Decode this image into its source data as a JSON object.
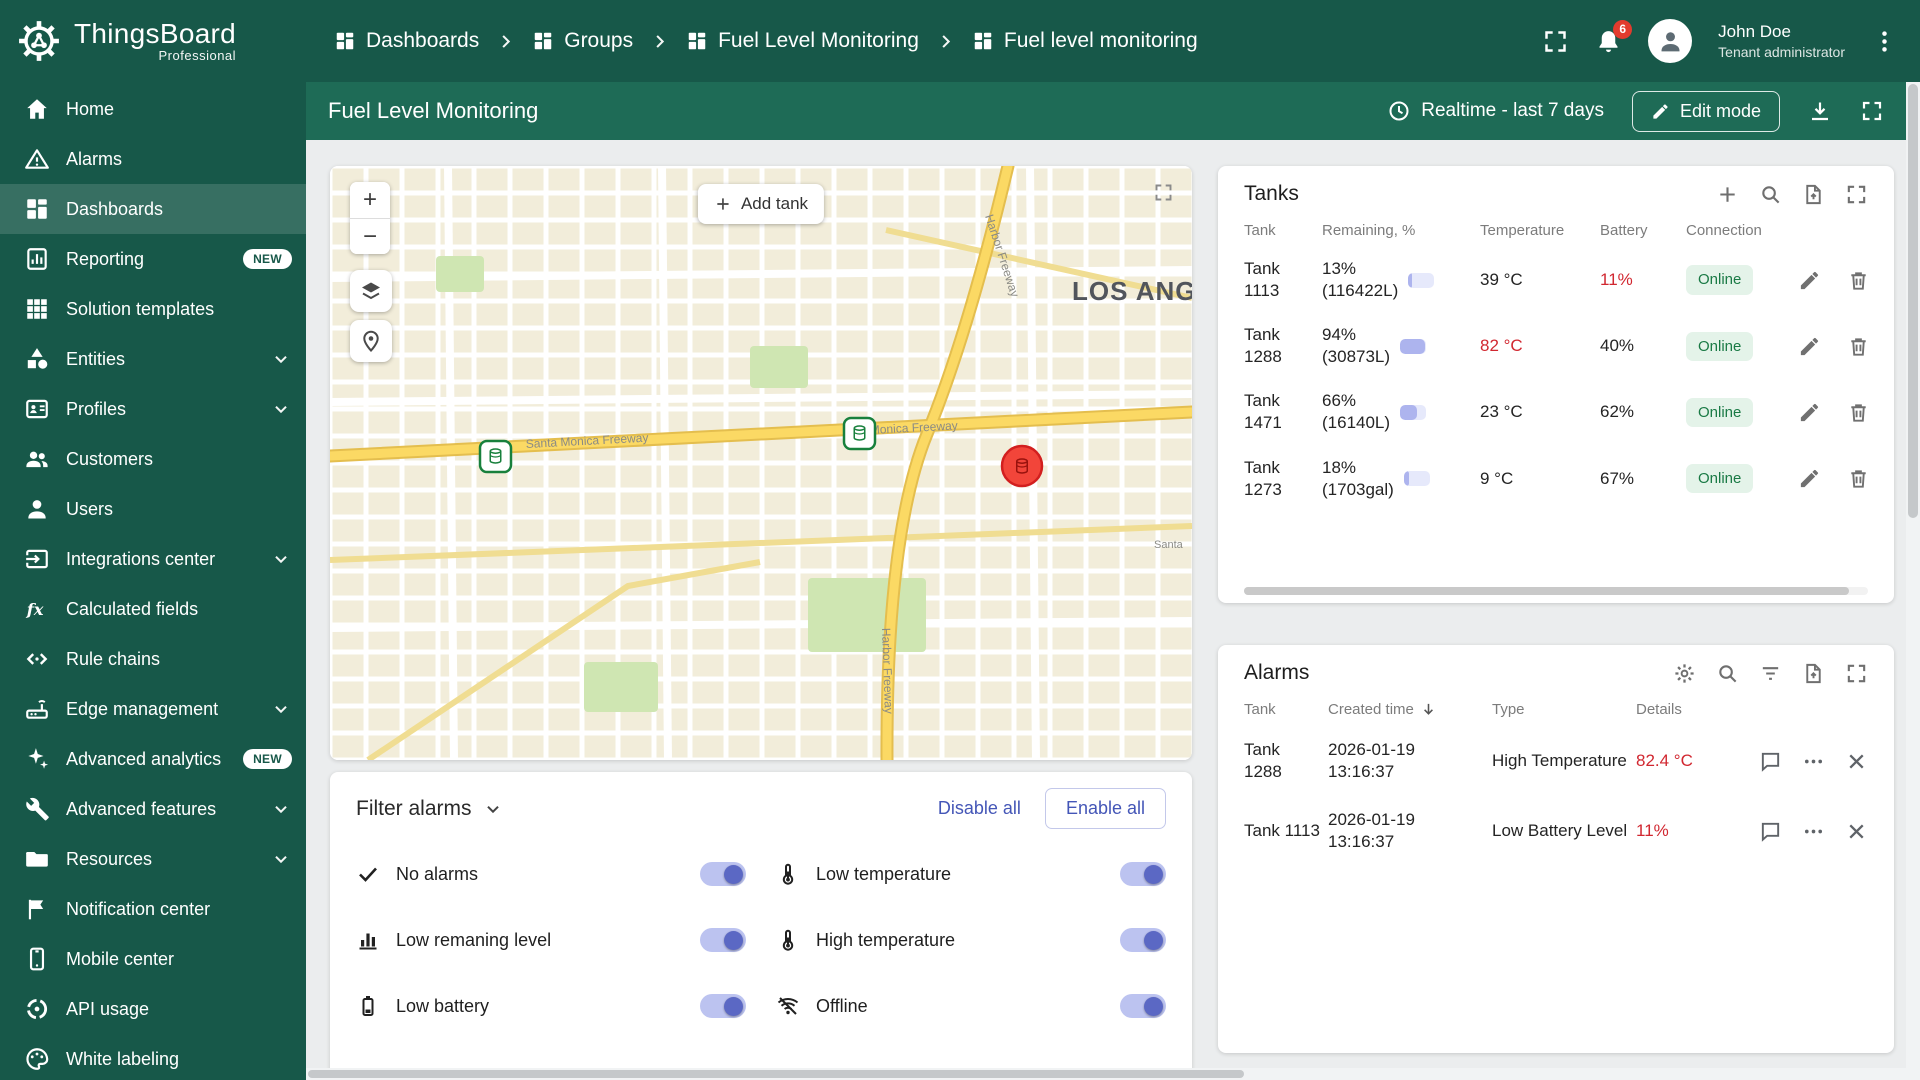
{
  "header": {
    "brand": "ThingsBoard",
    "brand_sub": "Professional",
    "breadcrumbs": [
      "Dashboards",
      "Groups",
      "Fuel Level Monitoring",
      "Fuel level monitoring"
    ],
    "notification_count": "6",
    "user_name": "John Doe",
    "user_role": "Tenant administrator"
  },
  "sidebar": {
    "items": [
      {
        "label": "Home"
      },
      {
        "label": "Alarms"
      },
      {
        "label": "Dashboards",
        "active": true
      },
      {
        "label": "Reporting",
        "badge": "NEW"
      },
      {
        "label": "Solution templates"
      },
      {
        "label": "Entities",
        "expandable": true
      },
      {
        "label": "Profiles",
        "expandable": true
      },
      {
        "label": "Customers"
      },
      {
        "label": "Users"
      },
      {
        "label": "Integrations center",
        "expandable": true
      },
      {
        "label": "Calculated fields"
      },
      {
        "label": "Rule chains"
      },
      {
        "label": "Edge management",
        "expandable": true
      },
      {
        "label": "Advanced analytics",
        "badge": "NEW"
      },
      {
        "label": "Advanced features",
        "expandable": true
      },
      {
        "label": "Resources",
        "expandable": true
      },
      {
        "label": "Notification center"
      },
      {
        "label": "Mobile center"
      },
      {
        "label": "API usage"
      },
      {
        "label": "White labeling"
      }
    ]
  },
  "toolbar": {
    "title": "Fuel Level Monitoring",
    "time_window": "Realtime - last 7 days",
    "edit_mode": "Edit mode"
  },
  "map": {
    "add_tank": "Add tank",
    "zoom_in": "+",
    "zoom_out": "−",
    "city_label": "LOS ANG",
    "road_label_1": "Santa Monica Freeway",
    "road_label_2": "Monica Freeway",
    "road_label_3": "Harbor Freeway",
    "road_label_4": "Harbor Freeway",
    "road_label_5": "Santa"
  },
  "tanks": {
    "title": "Tanks",
    "columns": {
      "tank": "Tank",
      "remaining": "Remaining, %",
      "temperature": "Temperature",
      "battery": "Battery",
      "connection": "Connection"
    },
    "rows": [
      {
        "name": "Tank 1113",
        "remaining_pct": "13%",
        "remaining_vol": "(116422L)",
        "level": 13,
        "temperature": "39 °C",
        "temperature_alarm": false,
        "battery": "11%",
        "battery_alarm": true,
        "connection": "Online"
      },
      {
        "name": "Tank 1288",
        "remaining_pct": "94%",
        "remaining_vol": "(30873L)",
        "level": 94,
        "temperature": "82 °C",
        "temperature_alarm": true,
        "battery": "40%",
        "battery_alarm": false,
        "connection": "Online"
      },
      {
        "name": "Tank 1471",
        "remaining_pct": "66%",
        "remaining_vol": "(16140L)",
        "level": 66,
        "temperature": "23 °C",
        "temperature_alarm": false,
        "battery": "62%",
        "battery_alarm": false,
        "connection": "Online"
      },
      {
        "name": "Tank 1273",
        "remaining_pct": "18%",
        "remaining_vol": "(1703gal)",
        "level": 18,
        "temperature": "9 °C",
        "temperature_alarm": false,
        "battery": "67%",
        "battery_alarm": false,
        "connection": "Online"
      }
    ]
  },
  "alarms": {
    "title": "Alarms",
    "columns": {
      "tank": "Tank",
      "created": "Created time",
      "type": "Type",
      "details": "Details"
    },
    "rows": [
      {
        "name": "Tank 1288",
        "date": "2026-01-19",
        "time": "13:16:37",
        "type": "High Temperature",
        "details": "82.4 °C"
      },
      {
        "name": "Tank 1113",
        "date": "2026-01-19",
        "time": "13:16:37",
        "type": "Low Battery Level",
        "details": "11%"
      }
    ]
  },
  "filters": {
    "title": "Filter alarms",
    "disable_all": "Disable all",
    "enable_all": "Enable all",
    "toggles": [
      {
        "label": "No alarms",
        "on": true
      },
      {
        "label": "Low temperature",
        "on": true
      },
      {
        "label": "Low remaning level",
        "on": true
      },
      {
        "label": "High temperature",
        "on": true
      },
      {
        "label": "Low battery",
        "on": true
      },
      {
        "label": "Offline",
        "on": true
      }
    ]
  },
  "colors": {
    "brand_green_dark": "#175849",
    "brand_green_mid": "#1e6b56",
    "accent_indigo": "#5b68c4",
    "alarm_red": "#d12730",
    "online_text": "#1a7a45",
    "online_bg": "#e4f3e9",
    "marker_green": "#18803c",
    "marker_red": "#f2453a"
  }
}
